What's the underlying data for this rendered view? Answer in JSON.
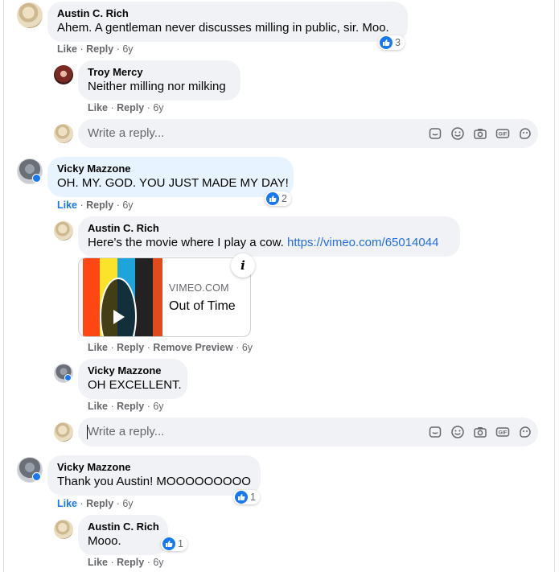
{
  "actions": {
    "like": "Like",
    "reply": "Reply",
    "remove_preview": "Remove Preview",
    "sep": "·"
  },
  "reply_placeholder": "Write a reply...",
  "reply_icons": [
    "sticker-icon",
    "emoji-icon",
    "camera-icon",
    "gif-icon",
    "sticker-face-icon"
  ],
  "colors": {
    "accent": "#1877f2",
    "link": "#216fdb",
    "bubble": "#f0f2f5",
    "bubble_highlight": "#e7f3ff"
  },
  "comments": {
    "c1": {
      "author": "Austin C. Rich",
      "text": "Ahem. A gentleman never discusses milling in public, sir. Moo.",
      "time": "6y",
      "reactions": "3"
    },
    "c1r1": {
      "author": "Troy Mercy",
      "text": "Neither milling nor milking",
      "time": "6y"
    },
    "c2": {
      "author": "Vicky Mazzone",
      "text": "OH. MY. GOD. YOU JUST MADE MY DAY!",
      "time": "6y",
      "reactions": "2"
    },
    "c2r1": {
      "author": "Austin C. Rich",
      "text": "Here's the movie where I play a cow.",
      "link": "https://vimeo.com/65014044",
      "time": "6y"
    },
    "c2r2": {
      "author": "Vicky Mazzone",
      "text": "OH EXCELLENT.",
      "time": "6y"
    },
    "c3": {
      "author": "Vicky Mazzone",
      "text": "Thank you Austin! MOOOOOOOOO",
      "time": "6y",
      "reactions": "1"
    },
    "c3r1": {
      "author": "Austin C. Rich",
      "text": "Mooo.",
      "time": "6y",
      "reactions": "1"
    }
  },
  "link_preview": {
    "domain": "VIMEO.COM",
    "title": "Out of Time",
    "info": "i",
    "stripes": [
      "#ff4713",
      "#fbe32c",
      "#1ea4d9",
      "#222222",
      "#e14a1b"
    ]
  }
}
